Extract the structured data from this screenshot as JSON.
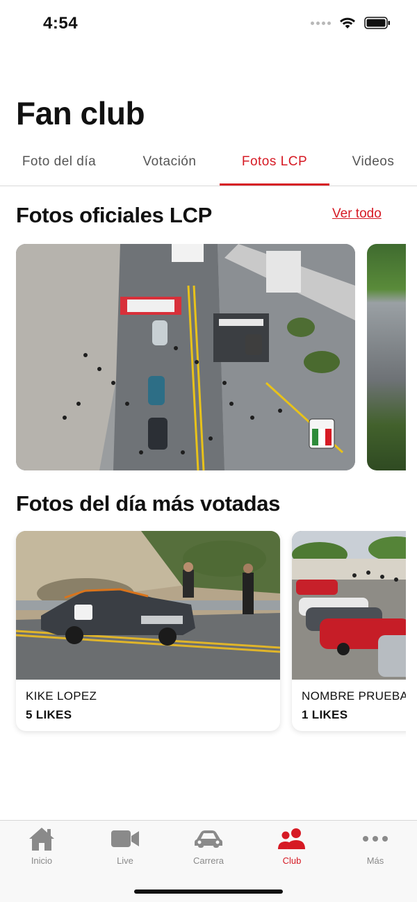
{
  "status": {
    "time": "4:54"
  },
  "page": {
    "title": "Fan club"
  },
  "tabs": [
    {
      "label": "Foto del día",
      "active": false
    },
    {
      "label": "Votación",
      "active": false
    },
    {
      "label": "Fotos LCP",
      "active": true
    },
    {
      "label": "Videos",
      "active": false
    }
  ],
  "official": {
    "title": "Fotos oficiales LCP",
    "see_all": "Ver todo"
  },
  "most_voted": {
    "title": "Fotos del día más votadas",
    "cards": [
      {
        "name": "KIKE LOPEZ",
        "likes": "5 LIKES"
      },
      {
        "name": "NOMBRE PRUEBA",
        "likes": "1 LIKES"
      }
    ]
  },
  "tab_bar": [
    {
      "label": "Inicio",
      "icon": "home-icon",
      "active": false
    },
    {
      "label": "Live",
      "icon": "video-icon",
      "active": false
    },
    {
      "label": "Carrera",
      "icon": "car-icon",
      "active": false
    },
    {
      "label": "Club",
      "icon": "users-icon",
      "active": true
    },
    {
      "label": "Más",
      "icon": "more-icon",
      "active": false
    }
  ],
  "colors": {
    "accent": "#d61a24",
    "inactive": "#8a8a8a"
  }
}
